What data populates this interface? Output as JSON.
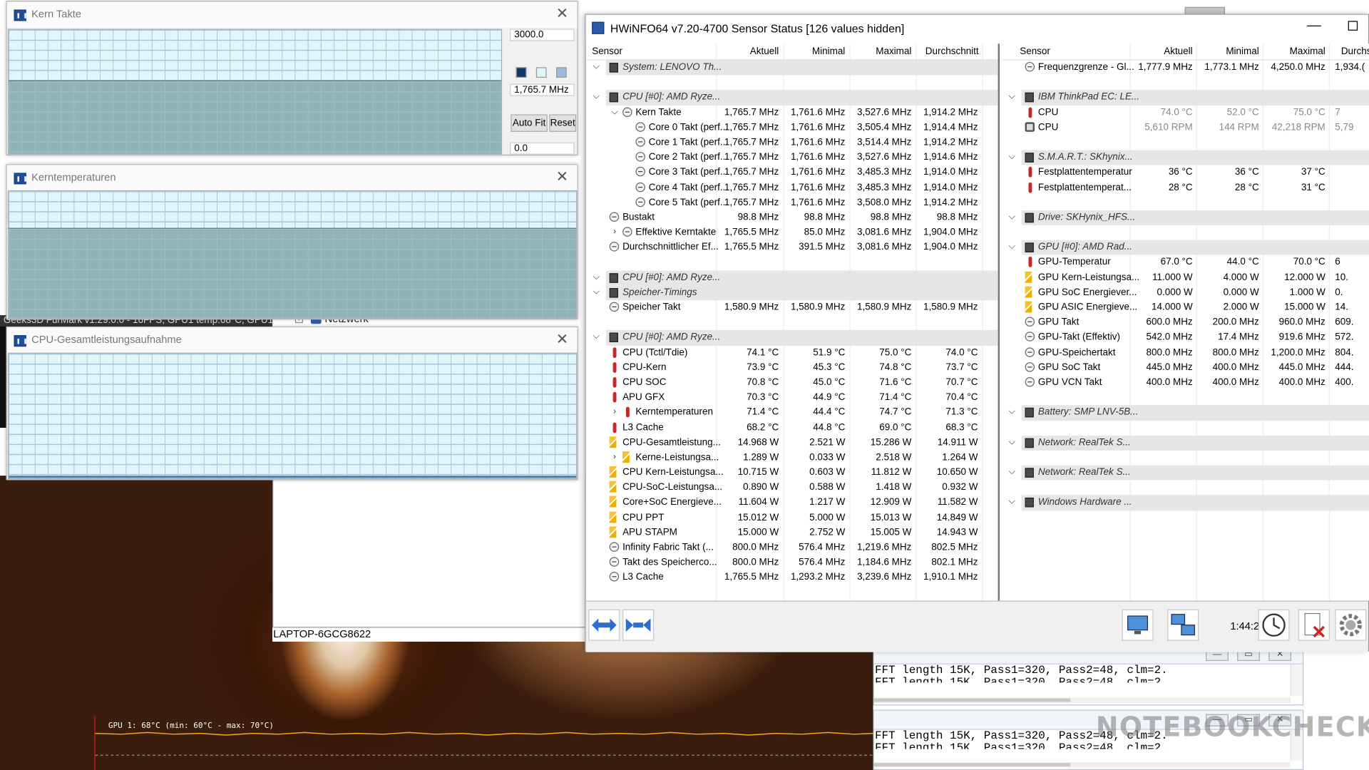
{
  "furmark": {
    "title": "Geeks3D FurMark v1.29.0.0 - 16FPS, GPU1 temp:68°C, GPU1",
    "graph_label": "GPU 1: 68°C (min: 60°C - max: 70°C)"
  },
  "hostname": "LAPTOP-6GCG8622",
  "netzwerk": "Netzwerk",
  "prime95": {
    "lines": [
      "FFT length 15K, Pass1=320, Pass2=48, clm=2.",
      "FFT length 15K, Pass1=320, Pass2=48, clm=2."
    ]
  },
  "watermark": "NOTEBOOKCHECK",
  "graphs": {
    "kern": {
      "title": "Kern Takte",
      "max": "3000.0",
      "cur": "1,765.7 MHz",
      "min": "0.0",
      "autofit": "Auto Fit",
      "reset": "Reset",
      "level": 0.59
    },
    "temp": {
      "title": "Kerntemperaturen",
      "level": 0.71
    },
    "power": {
      "title": "CPU-Gesamtleistungsaufnahme",
      "level": 0.02
    }
  },
  "hwinfo": {
    "title": "HWiNFO64 v7.20-4700 Sensor Status [126 values hidden]",
    "headers": {
      "sensor": "Sensor",
      "cur": "Aktuell",
      "min": "Minimal",
      "max": "Maximal",
      "avg": "Durchschnitt"
    },
    "headers_right": {
      "sensor": "Sensor",
      "cur": "Aktuell",
      "min": "Minimal",
      "max": "Maximal",
      "avg": "Durchs"
    },
    "time": "1:44:21",
    "left": [
      {
        "t": "g",
        "l": "System: LENOVO Th..."
      },
      {
        "t": "e"
      },
      {
        "t": "g",
        "l": "CPU [#0]: AMD Ryze..."
      },
      {
        "t": "s",
        "i": "clk",
        "ind": 1,
        "c": "v",
        "l": "Kern Takte",
        "v": [
          "1,765.7 MHz",
          "1,761.6 MHz",
          "3,527.6 MHz",
          "1,914.2 MHz"
        ]
      },
      {
        "t": "s",
        "i": "clk",
        "ind": 2,
        "l": "Core 0 Takt (perf...",
        "v": [
          "1,765.7 MHz",
          "1,761.6 MHz",
          "3,505.4 MHz",
          "1,914.4 MHz"
        ]
      },
      {
        "t": "s",
        "i": "clk",
        "ind": 2,
        "l": "Core 1 Takt (perf...",
        "v": [
          "1,765.7 MHz",
          "1,761.6 MHz",
          "3,514.4 MHz",
          "1,914.2 MHz"
        ]
      },
      {
        "t": "s",
        "i": "clk",
        "ind": 2,
        "l": "Core 2 Takt (perf...",
        "v": [
          "1,765.7 MHz",
          "1,761.6 MHz",
          "3,527.6 MHz",
          "1,914.6 MHz"
        ]
      },
      {
        "t": "s",
        "i": "clk",
        "ind": 2,
        "l": "Core 3 Takt (perf...",
        "v": [
          "1,765.7 MHz",
          "1,761.6 MHz",
          "3,485.3 MHz",
          "1,914.0 MHz"
        ]
      },
      {
        "t": "s",
        "i": "clk",
        "ind": 2,
        "l": "Core 4 Takt (perf...",
        "v": [
          "1,765.7 MHz",
          "1,761.6 MHz",
          "3,485.3 MHz",
          "1,914.0 MHz"
        ]
      },
      {
        "t": "s",
        "i": "clk",
        "ind": 2,
        "l": "Core 5 Takt (perf...",
        "v": [
          "1,765.7 MHz",
          "1,761.6 MHz",
          "3,508.0 MHz",
          "1,914.2 MHz"
        ]
      },
      {
        "t": "s",
        "i": "clk",
        "ind": 0,
        "l": "Bustakt",
        "v": [
          "98.8 MHz",
          "98.8 MHz",
          "98.8 MHz",
          "98.8 MHz"
        ]
      },
      {
        "t": "s",
        "i": "clk",
        "ind": 1,
        "c": ">",
        "l": "Effektive Kerntakte",
        "v": [
          "1,765.5 MHz",
          "85.0 MHz",
          "3,081.6 MHz",
          "1,904.0 MHz"
        ]
      },
      {
        "t": "s",
        "i": "clk",
        "ind": 0,
        "l": "Durchschnittlicher Ef...",
        "v": [
          "1,765.5 MHz",
          "391.5 MHz",
          "3,081.6 MHz",
          "1,904.0 MHz"
        ]
      },
      {
        "t": "e"
      },
      {
        "t": "g",
        "l": "CPU [#0]: AMD Ryze..."
      },
      {
        "t": "e0"
      },
      {
        "t": "g",
        "l": "Speicher-Timings"
      },
      {
        "t": "s",
        "i": "clk",
        "ind": 0,
        "l": "Speicher Takt",
        "v": [
          "1,580.9 MHz",
          "1,580.9 MHz",
          "1,580.9 MHz",
          "1,580.9 MHz"
        ]
      },
      {
        "t": "e"
      },
      {
        "t": "g",
        "l": "CPU [#0]: AMD Ryze..."
      },
      {
        "t": "s",
        "i": "thm",
        "ind": 0,
        "l": "CPU (Tctl/Tdie)",
        "v": [
          "74.1 °C",
          "51.9 °C",
          "75.0 °C",
          "74.0 °C"
        ]
      },
      {
        "t": "s",
        "i": "thm",
        "ind": 0,
        "l": "CPU-Kern",
        "v": [
          "73.9 °C",
          "45.3 °C",
          "74.8 °C",
          "73.7 °C"
        ]
      },
      {
        "t": "s",
        "i": "thm",
        "ind": 0,
        "l": "CPU SOC",
        "v": [
          "70.8 °C",
          "45.0 °C",
          "71.6 °C",
          "70.7 °C"
        ]
      },
      {
        "t": "s",
        "i": "thm",
        "ind": 0,
        "l": "APU GFX",
        "v": [
          "70.3 °C",
          "44.9 °C",
          "71.4 °C",
          "70.4 °C"
        ]
      },
      {
        "t": "s",
        "i": "thm",
        "ind": 1,
        "c": ">",
        "l": "Kerntemperaturen",
        "v": [
          "71.4 °C",
          "44.4 °C",
          "74.7 °C",
          "71.3 °C"
        ]
      },
      {
        "t": "s",
        "i": "thm",
        "ind": 0,
        "l": "L3 Cache",
        "v": [
          "68.2 °C",
          "44.8 °C",
          "69.0 °C",
          "68.3 °C"
        ]
      },
      {
        "t": "s",
        "i": "pwr",
        "ind": 0,
        "l": "CPU-Gesamtleistung...",
        "v": [
          "14.968 W",
          "2.521 W",
          "15.286 W",
          "14.911 W"
        ]
      },
      {
        "t": "s",
        "i": "pwr",
        "ind": 1,
        "c": ">",
        "l": "Kerne-Leistungsa...",
        "v": [
          "1.289 W",
          "0.033 W",
          "2.518 W",
          "1.264 W"
        ]
      },
      {
        "t": "s",
        "i": "pwr",
        "ind": 0,
        "l": "CPU Kern-Leistungsa...",
        "v": [
          "10.715 W",
          "0.603 W",
          "11.812 W",
          "10.650 W"
        ]
      },
      {
        "t": "s",
        "i": "pwr",
        "ind": 0,
        "l": "CPU-SoC-Leistungsa...",
        "v": [
          "0.890 W",
          "0.588 W",
          "1.418 W",
          "0.932 W"
        ]
      },
      {
        "t": "s",
        "i": "pwr",
        "ind": 0,
        "l": "Core+SoC Energieve...",
        "v": [
          "11.604 W",
          "1.217 W",
          "12.909 W",
          "11.582 W"
        ]
      },
      {
        "t": "s",
        "i": "pwr",
        "ind": 0,
        "l": "CPU PPT",
        "v": [
          "15.012 W",
          "5.000 W",
          "15.013 W",
          "14.849 W"
        ]
      },
      {
        "t": "s",
        "i": "pwr",
        "ind": 0,
        "l": "APU STAPM",
        "v": [
          "15.000 W",
          "2.752 W",
          "15.005 W",
          "14.943 W"
        ]
      },
      {
        "t": "s",
        "i": "clk",
        "ind": 0,
        "l": "Infinity Fabric Takt (...",
        "v": [
          "800.0 MHz",
          "576.4 MHz",
          "1,219.6 MHz",
          "802.5 MHz"
        ]
      },
      {
        "t": "s",
        "i": "clk",
        "ind": 0,
        "l": "Takt des Speicherco...",
        "v": [
          "800.0 MHz",
          "576.4 MHz",
          "1,184.6 MHz",
          "802.1 MHz"
        ]
      },
      {
        "t": "s",
        "i": "clk",
        "ind": 0,
        "l": "L3 Cache",
        "v": [
          "1,765.5 MHz",
          "1,293.2 MHz",
          "3,239.6 MHz",
          "1,910.1 MHz"
        ]
      }
    ],
    "right": [
      {
        "t": "s",
        "i": "clk",
        "ind": 0,
        "l": "Frequenzgrenze - Gl...",
        "v": [
          "1,777.9 MHz",
          "1,773.1 MHz",
          "4,250.0 MHz",
          "1,934.("
        ]
      },
      {
        "t": "e"
      },
      {
        "t": "g",
        "l": "IBM ThinkPad EC: LE..."
      },
      {
        "t": "s",
        "i": "thm",
        "ind": 0,
        "d": 1,
        "l": "CPU",
        "v": [
          "74.0 °C",
          "52.0 °C",
          "75.0 °C",
          "7"
        ]
      },
      {
        "t": "s",
        "i": "fan",
        "ind": 0,
        "d": 1,
        "l": "CPU",
        "v": [
          "5,610 RPM",
          "144 RPM",
          "42,218 RPM",
          "5,79"
        ]
      },
      {
        "t": "e"
      },
      {
        "t": "g",
        "l": "S.M.A.R.T.: SKhynix..."
      },
      {
        "t": "s",
        "i": "thm",
        "ind": 0,
        "l": "Festplattentemperatur",
        "v": [
          "36 °C",
          "36 °C",
          "37 °C",
          ""
        ]
      },
      {
        "t": "s",
        "i": "thm",
        "ind": 0,
        "l": "Festplattentemperat...",
        "v": [
          "28 °C",
          "28 °C",
          "31 °C",
          ""
        ]
      },
      {
        "t": "e"
      },
      {
        "t": "g",
        "l": "Drive: SKHynix_HFS..."
      },
      {
        "t": "e"
      },
      {
        "t": "g",
        "l": "GPU [#0]: AMD Rad..."
      },
      {
        "t": "s",
        "i": "thm",
        "ind": 0,
        "l": "GPU-Temperatur",
        "v": [
          "67.0 °C",
          "44.0 °C",
          "70.0 °C",
          "6"
        ]
      },
      {
        "t": "s",
        "i": "pwr",
        "ind": 0,
        "l": "GPU Kern-Leistungsa...",
        "v": [
          "11.000 W",
          "4.000 W",
          "12.000 W",
          "10."
        ]
      },
      {
        "t": "s",
        "i": "pwr",
        "ind": 0,
        "l": "GPU SoC Energiever...",
        "v": [
          "0.000 W",
          "0.000 W",
          "1.000 W",
          "0."
        ]
      },
      {
        "t": "s",
        "i": "pwr",
        "ind": 0,
        "l": "GPU ASIC Energieve...",
        "v": [
          "14.000 W",
          "2.000 W",
          "15.000 W",
          "14."
        ]
      },
      {
        "t": "s",
        "i": "clk",
        "ind": 0,
        "l": "GPU Takt",
        "v": [
          "600.0 MHz",
          "200.0 MHz",
          "960.0 MHz",
          "609."
        ]
      },
      {
        "t": "s",
        "i": "clk",
        "ind": 0,
        "l": "GPU-Takt (Effektiv)",
        "v": [
          "542.0 MHz",
          "17.4 MHz",
          "919.6 MHz",
          "572."
        ]
      },
      {
        "t": "s",
        "i": "clk",
        "ind": 0,
        "l": "GPU-Speichertakt",
        "v": [
          "800.0 MHz",
          "800.0 MHz",
          "1,200.0 MHz",
          "804."
        ]
      },
      {
        "t": "s",
        "i": "clk",
        "ind": 0,
        "l": "GPU SoC Takt",
        "v": [
          "445.0 MHz",
          "400.0 MHz",
          "445.0 MHz",
          "444."
        ]
      },
      {
        "t": "s",
        "i": "clk",
        "ind": 0,
        "l": "GPU VCN Takt",
        "v": [
          "400.0 MHz",
          "400.0 MHz",
          "400.0 MHz",
          "400."
        ]
      },
      {
        "t": "e"
      },
      {
        "t": "g",
        "l": "Battery: SMP LNV-5B..."
      },
      {
        "t": "e"
      },
      {
        "t": "g",
        "l": "Network: RealTek S..."
      },
      {
        "t": "e"
      },
      {
        "t": "g",
        "l": "Network: RealTek S..."
      },
      {
        "t": "e"
      },
      {
        "t": "g",
        "l": "Windows Hardware ..."
      }
    ]
  }
}
